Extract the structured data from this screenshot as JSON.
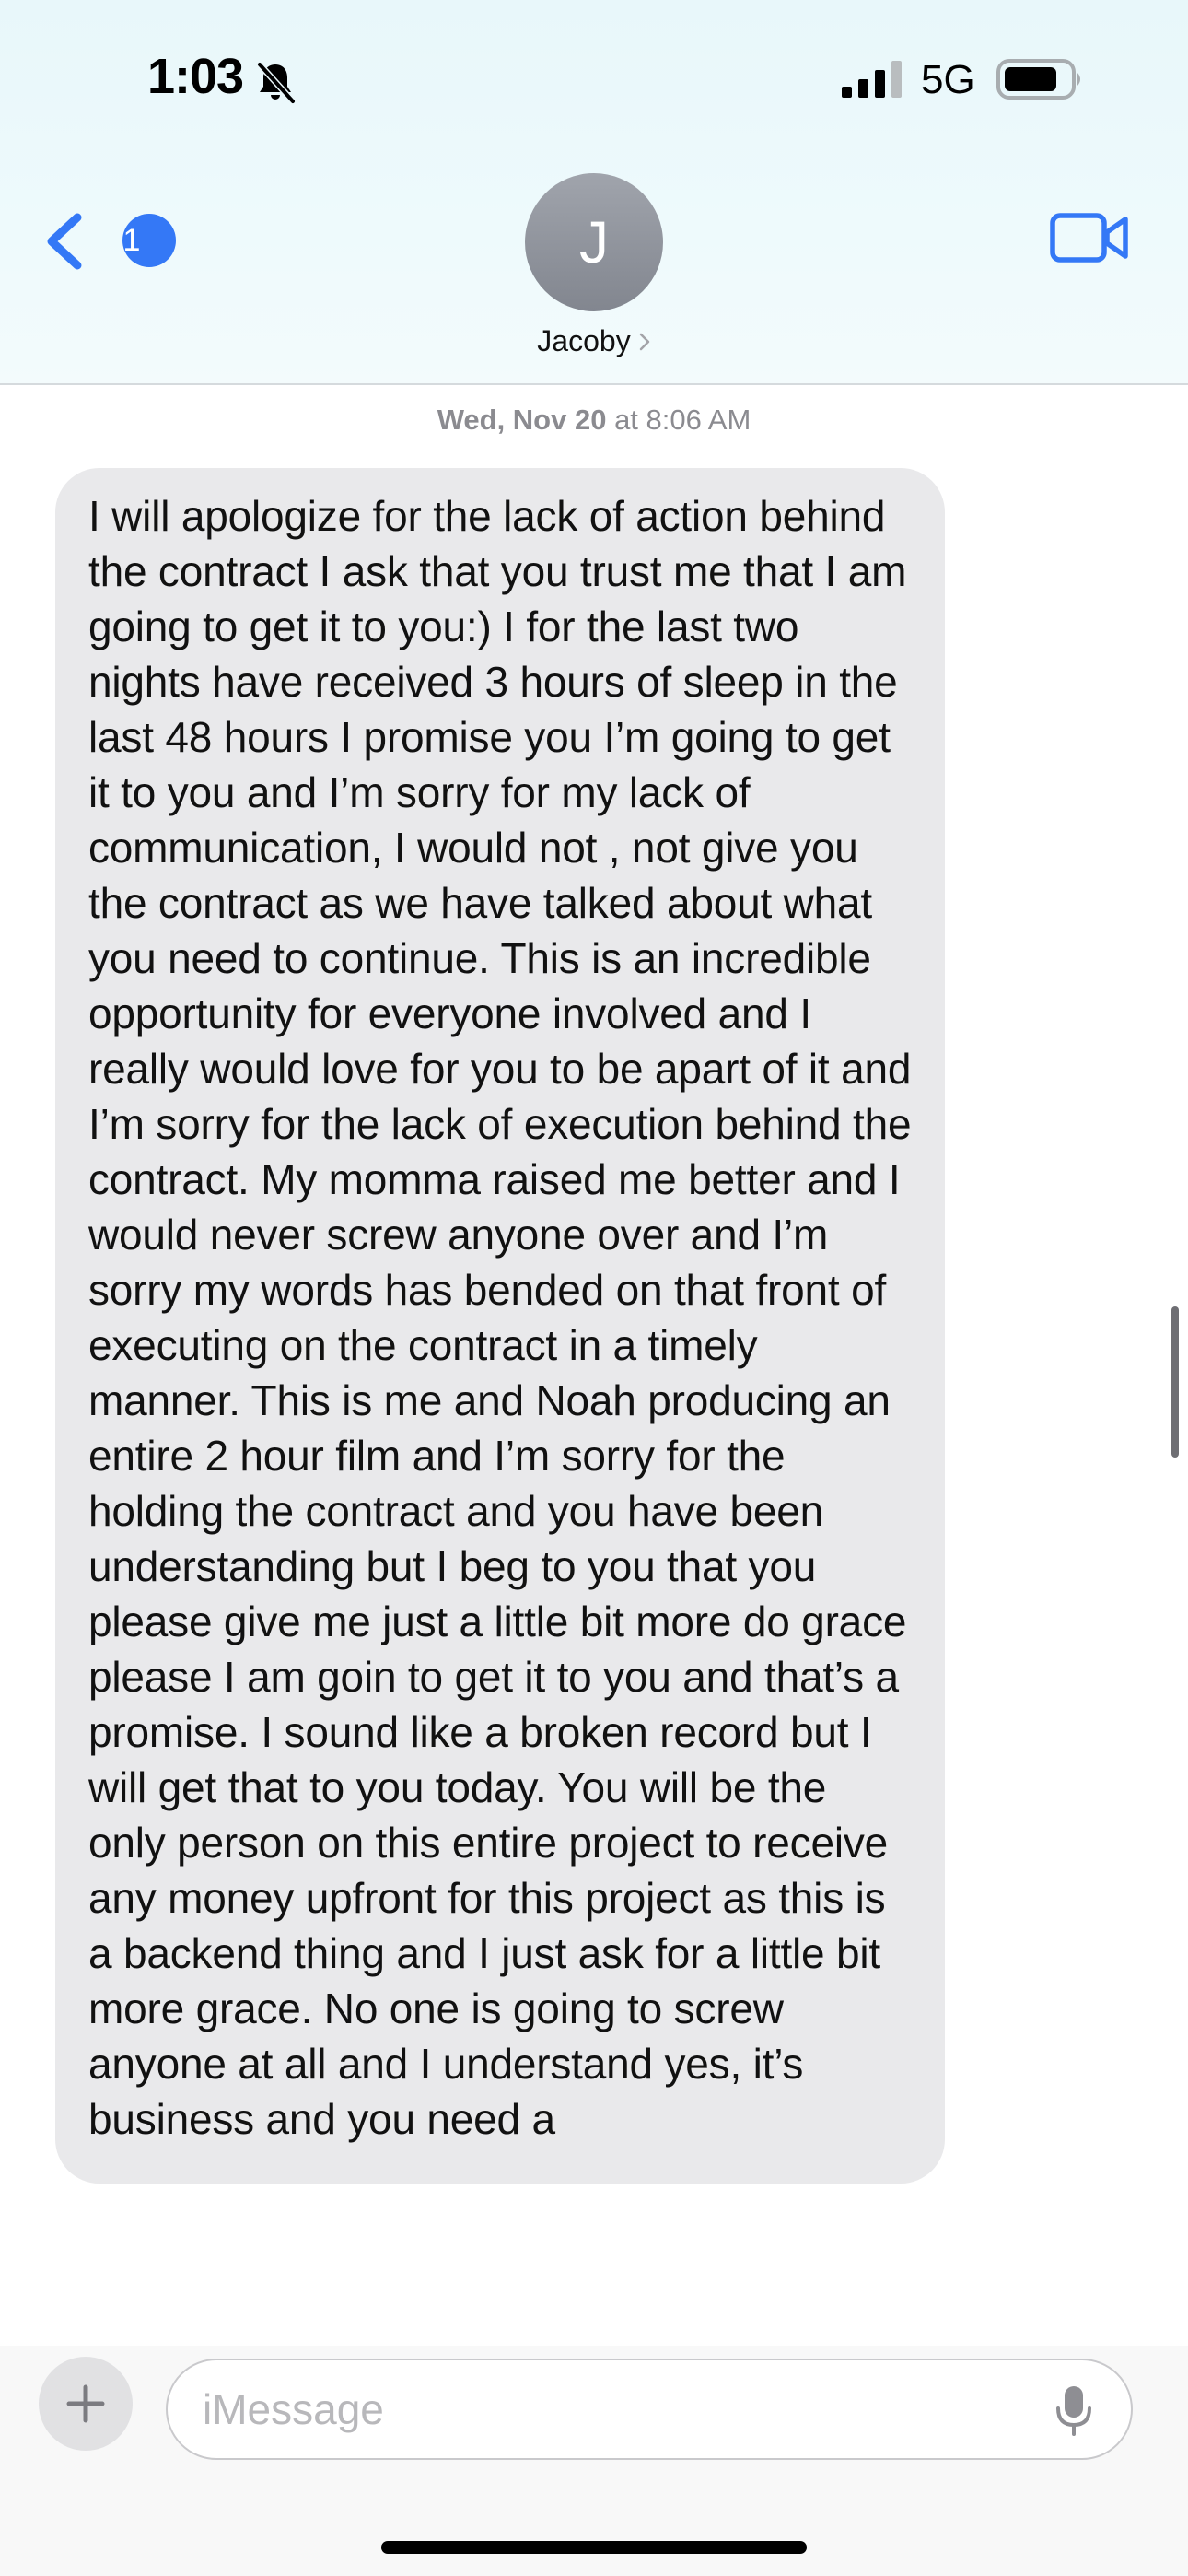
{
  "status_bar": {
    "time": "1:03",
    "network": "5G",
    "icons": [
      "bell-slash-icon",
      "cellular-signal-icon",
      "battery-icon"
    ]
  },
  "header": {
    "back_unread_count": "1",
    "avatar_initial": "J",
    "contact_name": "Jacoby",
    "icons": [
      "chevron-left-icon",
      "chevron-right-icon",
      "video-camera-icon"
    ]
  },
  "conversation": {
    "timestamp_day": "Wed, Nov 20",
    "timestamp_sep": " at ",
    "timestamp_time": "8:06 AM",
    "messages": [
      {
        "direction": "incoming",
        "text": "I will apologize for the lack of action behind the contract I ask that you trust me that I am going to get it to you:) I for the last two nights have received 3 hours of sleep in the last 48 hours I promise you I’m going to get it to you and I’m sorry for my lack of communication, I would not , not give you the contract as we have talked about what you need to continue. This is an incredible opportunity for everyone involved and I really would love for you to be apart of it and I’m sorry for the lack of execution behind the contract. My momma raised me better and I would never screw anyone over and I’m sorry my words has bended on that front of executing on the contract in a timely manner. This is me and Noah producing an entire 2 hour film and I’m sorry for the holding the contract and you have been understanding but I beg to you that you please give me just a little bit more do grace please I am goin to get it to you and that’s a promise. I sound like a broken record but I will get that to you today. You will be the only person on this entire project to receive any money upfront for this project as this is a backend thing and I just ask for a little bit more grace. No one is going to screw anyone at all and I understand yes, it’s business and you need a"
      }
    ]
  },
  "composer": {
    "placeholder": "iMessage",
    "value": "",
    "icons": [
      "plus-icon",
      "microphone-icon"
    ]
  },
  "colors": {
    "accent": "#3478f6",
    "incoming_bubble": "#e9e9eb",
    "header_bg": "#eaf8fb"
  }
}
